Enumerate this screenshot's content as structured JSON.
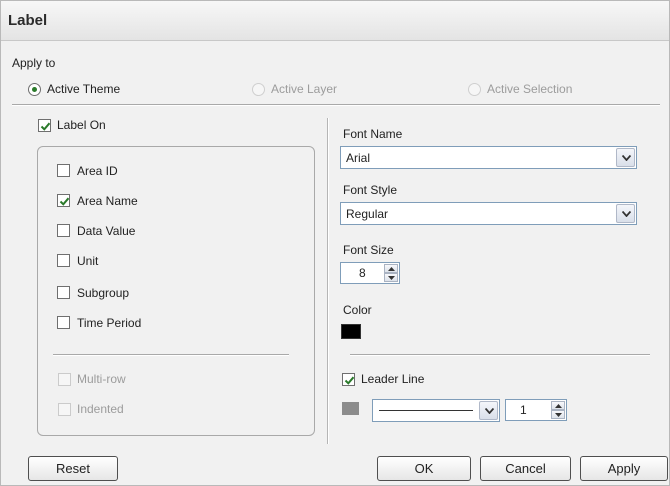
{
  "window": {
    "title": "Label"
  },
  "apply_to": {
    "label": "Apply to",
    "options": [
      {
        "label": "Active Theme",
        "selected": true,
        "enabled": true
      },
      {
        "label": "Active Layer",
        "selected": false,
        "enabled": false
      },
      {
        "label": "Active Selection",
        "selected": false,
        "enabled": false
      }
    ]
  },
  "label_on": {
    "label": "Label On",
    "checked": true
  },
  "fields": [
    {
      "label": "Area ID",
      "checked": false
    },
    {
      "label": "Area Name",
      "checked": true
    },
    {
      "label": "Data Value",
      "checked": false
    },
    {
      "label": "Unit",
      "checked": false
    },
    {
      "label": "Subgroup",
      "checked": false
    },
    {
      "label": "Time Period",
      "checked": false
    }
  ],
  "layout_options": [
    {
      "label": "Multi-row",
      "checked": false,
      "enabled": false
    },
    {
      "label": "Indented",
      "checked": false,
      "enabled": false
    }
  ],
  "font": {
    "name_label": "Font Name",
    "name_value": "Arial",
    "style_label": "Font Style",
    "style_value": "Regular",
    "size_label": "Font Size",
    "size_value": "8",
    "color_label": "Color",
    "color_value": "#000000"
  },
  "leader_line": {
    "label": "Leader Line",
    "checked": true,
    "color": "#8c8c8c",
    "width_value": "1"
  },
  "buttons": {
    "reset": "Reset",
    "ok": "OK",
    "cancel": "Cancel",
    "apply": "Apply"
  },
  "colors": {
    "check_green": "#2a7a2a",
    "input_border": "#7f9db9"
  }
}
